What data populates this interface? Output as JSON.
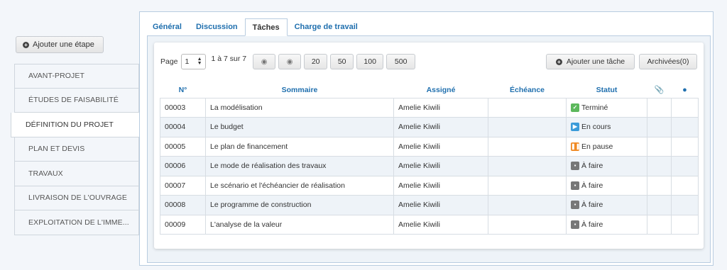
{
  "left": {
    "add_step_label": "Ajouter une étape",
    "steps": [
      {
        "label": "AVANT-PROJET"
      },
      {
        "label": "ÉTUDES DE FAISABILITÉ"
      },
      {
        "label": "DÉFINITION DU PROJET",
        "active": true
      },
      {
        "label": "PLAN ET DEVIS"
      },
      {
        "label": "TRAVAUX"
      },
      {
        "label": "LIVRAISON DE L'OUVRAGE"
      },
      {
        "label": "EXPLOITATION DE L'IMME..."
      }
    ]
  },
  "tabs": [
    {
      "label": "Général"
    },
    {
      "label": "Discussion"
    },
    {
      "label": "Tâches",
      "active": true
    },
    {
      "label": "Charge de travail"
    }
  ],
  "toolbar": {
    "page_label": "Page",
    "page_value": "1",
    "range_label": "1 à 7 sur 7",
    "page_sizes": [
      "20",
      "50",
      "100",
      "500"
    ],
    "add_task_label": "Ajouter une tâche",
    "archive_label": "Archivées(0)"
  },
  "table": {
    "headers": {
      "num": "N°",
      "summary": "Sommaire",
      "assignee": "Assigné",
      "due": "Échéance",
      "status": "Statut"
    },
    "rows": [
      {
        "num": "00003",
        "summary": "La modélisation",
        "assignee": "Amelie Kiwili",
        "due": "",
        "status": "Terminé",
        "status_color": "#5cb85c",
        "status_icon": "check-icon"
      },
      {
        "num": "00004",
        "summary": "Le budget",
        "assignee": "Amelie Kiwili",
        "due": "",
        "status": "En cours",
        "status_color": "#3b9bd9",
        "status_icon": "play-icon"
      },
      {
        "num": "00005",
        "summary": "Le plan de financement",
        "assignee": "Amelie Kiwili",
        "due": "",
        "status": "En pause",
        "status_color": "#f08a24",
        "status_icon": "pause-icon"
      },
      {
        "num": "00006",
        "summary": "Le mode de réalisation des travaux",
        "assignee": "Amelie Kiwili",
        "due": "",
        "status": "À faire",
        "status_color": "#777777",
        "status_icon": "todo-icon"
      },
      {
        "num": "00007",
        "summary": "Le scénario et l'échéancier de réalisation",
        "assignee": "Amelie Kiwili",
        "due": "",
        "status": "À faire",
        "status_color": "#777777",
        "status_icon": "todo-icon"
      },
      {
        "num": "00008",
        "summary": "Le programme de construction",
        "assignee": "Amelie Kiwili",
        "due": "",
        "status": "À faire",
        "status_color": "#777777",
        "status_icon": "todo-icon"
      },
      {
        "num": "00009",
        "summary": "L'analyse de la valeur",
        "assignee": "Amelie Kiwili",
        "due": "",
        "status": "À faire",
        "status_color": "#777777",
        "status_icon": "todo-icon"
      }
    ]
  },
  "colors": {
    "accent": "#1f6fae",
    "border": "#b8cce0",
    "stripe": "#eef3f8"
  }
}
